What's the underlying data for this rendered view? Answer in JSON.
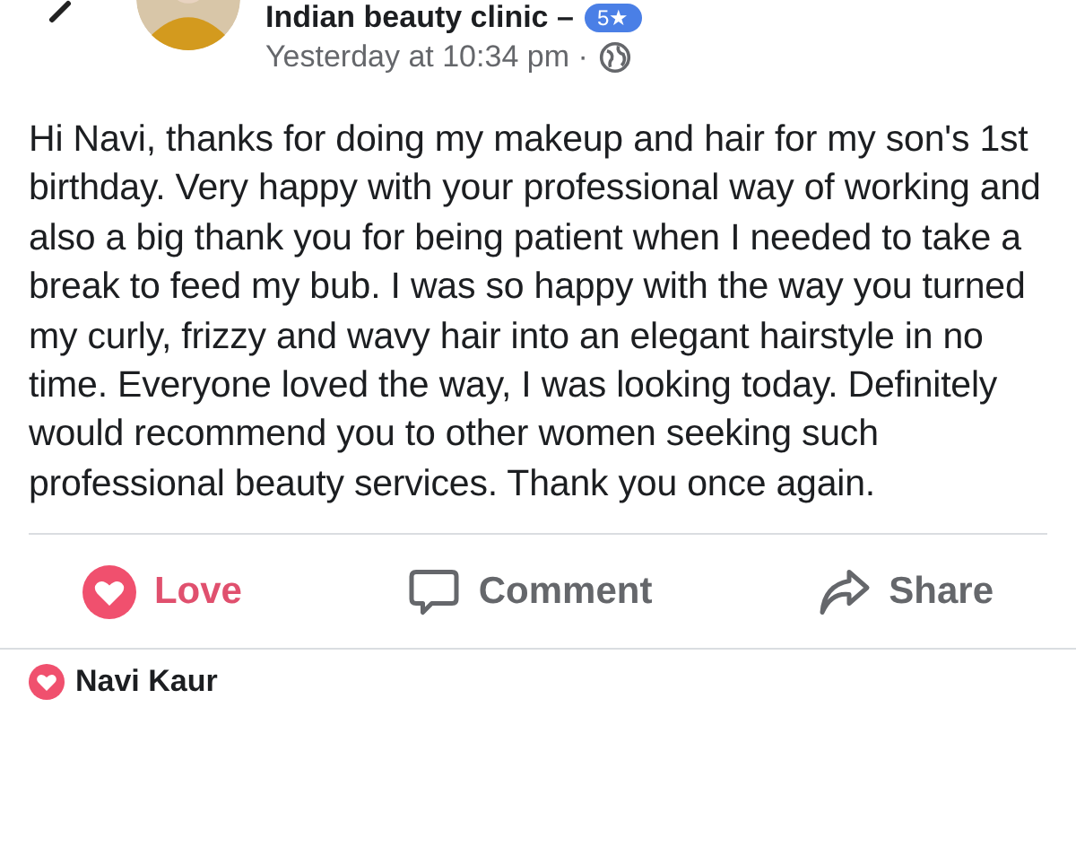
{
  "post": {
    "author": "Indian beauty clinic –",
    "rating_badge": "5★",
    "timestamp": "Yesterday at 10:34 pm ·",
    "text": "Hi Navi, thanks for doing my makeup and hair for my son's 1st birthday. Very happy with your professional way of working and also a big thank you for being patient when I needed to take a break to feed my bub. I was so happy with the way you turned my curly, frizzy and wavy hair into an elegant hairstyle in no time. Everyone loved the way, I was looking today. Definitely would recommend you to other women seeking such professional beauty services. Thank you once again."
  },
  "actions": [
    {
      "kind": "react",
      "label": "Love",
      "selected": true
    },
    {
      "kind": "comment",
      "label": "Comment",
      "selected": false
    },
    {
      "kind": "share",
      "label": "Share",
      "selected": false
    }
  ],
  "reactions": [
    {
      "name": "Navi Kaur"
    }
  ]
}
